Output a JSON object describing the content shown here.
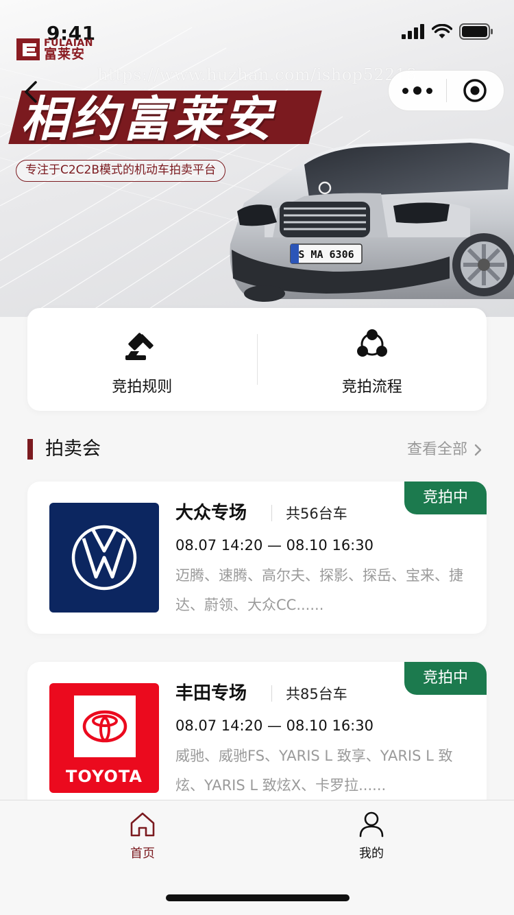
{
  "status_bar": {
    "time": "9:41"
  },
  "brand": {
    "logo_en": "FULAIAN",
    "logo_cn": "富莱安"
  },
  "watermark": "https://www.huzhan.com/ishop52218",
  "hero": {
    "slogan": "相约富莱安",
    "tagline": "专注于C2C2B模式的机动车拍卖平台",
    "plate": "S MA 6306"
  },
  "nav_capsule": {
    "more_icon": "more-dots-icon",
    "close_icon": "target-circle-icon"
  },
  "entries": [
    {
      "label": "竞拍规则",
      "icon": "gavel-icon"
    },
    {
      "label": "竞拍流程",
      "icon": "process-cycle-icon"
    }
  ],
  "section": {
    "title": "拍卖会",
    "more": "查看全部"
  },
  "auctions": [
    {
      "brand": "大众专场",
      "count": "共56台车",
      "time": "08.07 14:20 — 08.10 16:30",
      "models": "迈腾、速腾、高尔夫、探影、探岳、宝来、捷达、蔚领、大众CC......",
      "status": "竞拍中",
      "logo": "vw-logo",
      "logo_bg": "#0c2660"
    },
    {
      "brand": "丰田专场",
      "count": "共85台车",
      "time": "08.07 14:20 — 08.10 16:30",
      "models": "威驰、威驰FS、YARIS L 致享、YARIS L 致炫、YARIS L 致炫X、卡罗拉......",
      "status": "竞拍中",
      "logo": "toyota-logo",
      "logo_text": "TOYOTA",
      "logo_bg": "#eb0a1e"
    }
  ],
  "tabbar": [
    {
      "label": "首页",
      "icon": "home-icon",
      "active": true,
      "color": "#7b1a1f"
    },
    {
      "label": "我的",
      "icon": "user-icon",
      "active": false,
      "color": "#111111"
    }
  ],
  "colors": {
    "brand": "#7b1a1f",
    "status_green": "#1c7a4e"
  }
}
